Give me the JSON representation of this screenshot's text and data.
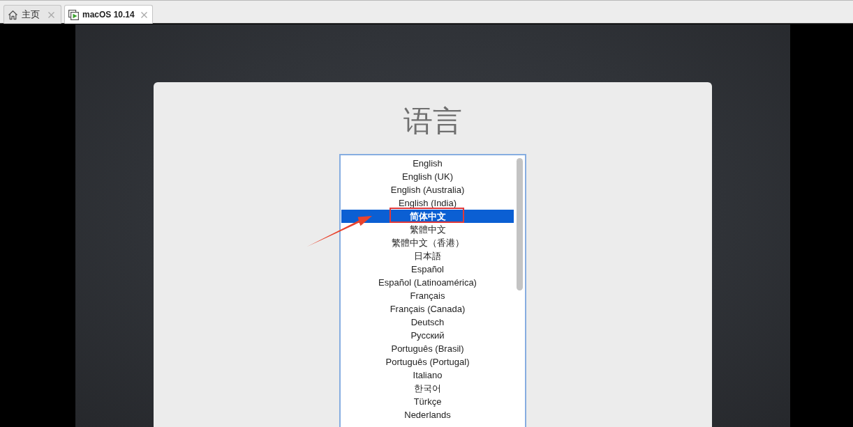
{
  "tabs": [
    {
      "label": "主页",
      "kind": "home",
      "selected": false
    },
    {
      "label": "macOS 10.14",
      "kind": "vm",
      "selected": true
    }
  ],
  "dialog": {
    "title": "语言",
    "languages": [
      {
        "label": "English",
        "selected": false,
        "marked": false
      },
      {
        "label": "English (UK)",
        "selected": false,
        "marked": false
      },
      {
        "label": "English (Australia)",
        "selected": false,
        "marked": false
      },
      {
        "label": "English (India)",
        "selected": false,
        "marked": false
      },
      {
        "label": "简体中文",
        "selected": true,
        "marked": true
      },
      {
        "label": "繁體中文",
        "selected": false,
        "marked": false
      },
      {
        "label": "繁體中文（香港）",
        "selected": false,
        "marked": false
      },
      {
        "label": "日本語",
        "selected": false,
        "marked": false
      },
      {
        "label": "Español",
        "selected": false,
        "marked": false
      },
      {
        "label": "Español (Latinoamérica)",
        "selected": false,
        "marked": false
      },
      {
        "label": "Français",
        "selected": false,
        "marked": false
      },
      {
        "label": "Français (Canada)",
        "selected": false,
        "marked": false
      },
      {
        "label": "Deutsch",
        "selected": false,
        "marked": false
      },
      {
        "label": "Русский",
        "selected": false,
        "marked": false
      },
      {
        "label": "Português (Brasil)",
        "selected": false,
        "marked": false
      },
      {
        "label": "Português (Portugal)",
        "selected": false,
        "marked": false
      },
      {
        "label": "Italiano",
        "selected": false,
        "marked": false
      },
      {
        "label": "한국어",
        "selected": false,
        "marked": false
      },
      {
        "label": "Türkçe",
        "selected": false,
        "marked": false
      },
      {
        "label": "Nederlands",
        "selected": false,
        "marked": false
      }
    ]
  }
}
